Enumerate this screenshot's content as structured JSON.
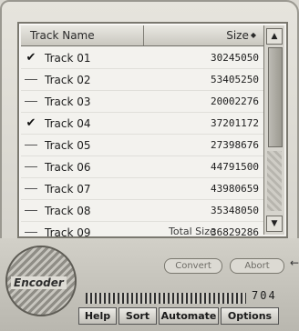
{
  "list": {
    "columns": {
      "name": "Track Name",
      "size": "Size"
    },
    "rows": [
      {
        "checked": true,
        "name": "Track 01",
        "size": "30245050"
      },
      {
        "checked": false,
        "name": "Track 02",
        "size": "53405250"
      },
      {
        "checked": false,
        "name": "Track 03",
        "size": "20002276"
      },
      {
        "checked": true,
        "name": "Track 04",
        "size": "37201172"
      },
      {
        "checked": false,
        "name": "Track 05",
        "size": "27398676"
      },
      {
        "checked": false,
        "name": "Track 06",
        "size": "44791500"
      },
      {
        "checked": false,
        "name": "Track 07",
        "size": "43980659"
      },
      {
        "checked": false,
        "name": "Track 08",
        "size": "35348050"
      },
      {
        "checked": false,
        "name": "Track 09",
        "size": "36829286"
      }
    ],
    "total_label": "Total Size"
  },
  "encoder": {
    "label": "Encoder"
  },
  "actions": {
    "convert": "Convert",
    "abort": "Abort"
  },
  "counter": "704",
  "toolbar": {
    "help": "Help",
    "sort": "Sort",
    "automate": "Automate",
    "options": "Options"
  },
  "icons": {
    "sort": "sort-indicator-icon",
    "check": "checkmark-icon",
    "scroll_up": "scroll-up-arrow-icon",
    "scroll_down": "scroll-down-arrow-icon"
  }
}
